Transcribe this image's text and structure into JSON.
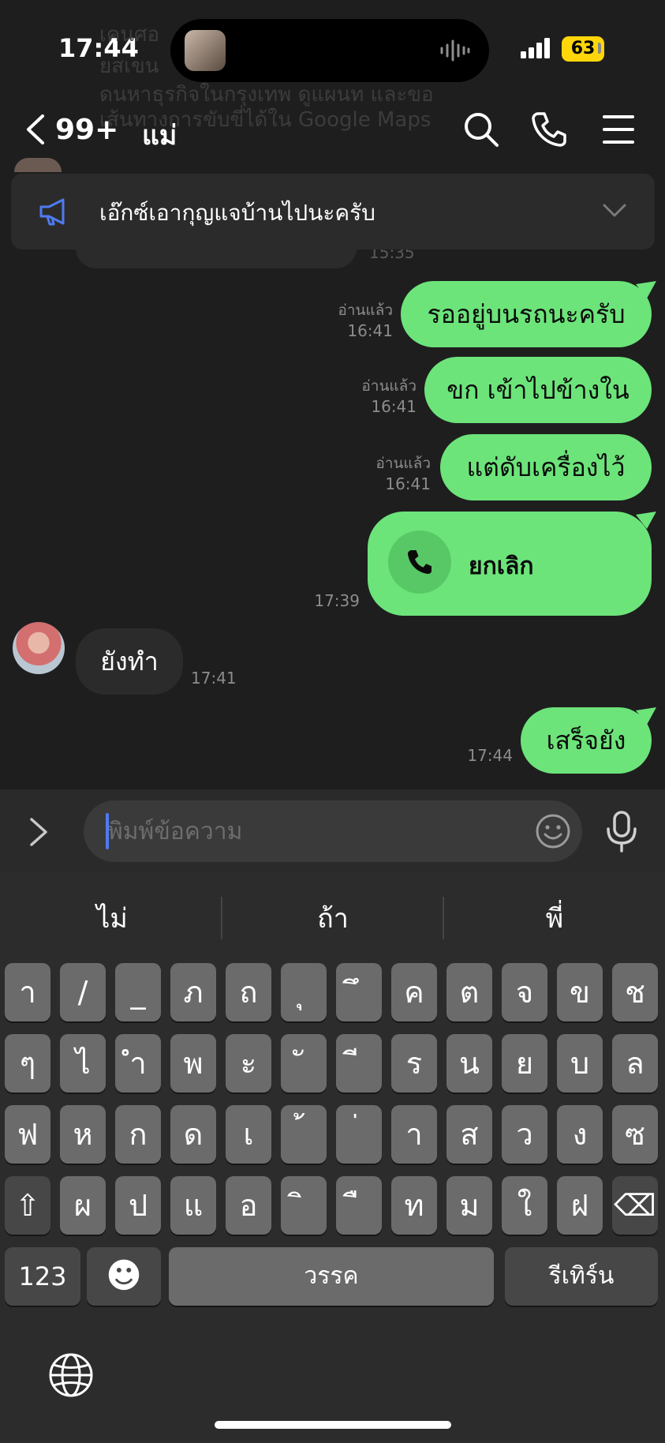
{
  "status_bar": {
    "time": "17:44",
    "battery": "63"
  },
  "ghost_text": [
    "เคนศอ",
    "ยสเขน",
    "ดนหาธุรกิจในกรุงเทพ ดูแผนท และขอ",
    "เส้นทางการขับขี่ได้ใน Google Maps"
  ],
  "header": {
    "unread_count": "99+",
    "chat_name": "แม่"
  },
  "announcement": {
    "text": "เอ๊กซ์เอากุญแจบ้านไปนะครับ"
  },
  "old_message": {
    "time": "15:35"
  },
  "messages": [
    {
      "text": "รออยู่บนรถนะครับ",
      "read": "อ่านแล้ว",
      "time": "16:41"
    },
    {
      "text": "ขก เข้าไปข้างใน",
      "read": "อ่านแล้ว",
      "time": "16:41"
    },
    {
      "text": "แต่ดับเครื่องไว้",
      "read": "อ่านแล้ว",
      "time": "16:41"
    },
    {
      "text": "ยกเลิก",
      "time": "17:39"
    },
    {
      "text": "ยังทำ",
      "time": "17:41"
    },
    {
      "text": "เสร็จยัง",
      "time": "17:44"
    }
  ],
  "input": {
    "placeholder": "พิมพ์ข้อความ"
  },
  "keyboard": {
    "suggestions": [
      "ไม่",
      "ถ้า",
      "พี่"
    ],
    "row1": [
      "า",
      "/",
      "_",
      "ภ",
      "ถ",
      "ุ",
      "ึ",
      "ค",
      "ต",
      "จ",
      "ข",
      "ช"
    ],
    "row2": [
      "ๆ",
      "ไ",
      "ำ",
      "พ",
      "ะ",
      "ั",
      "ี",
      "ร",
      "น",
      "ย",
      "บ",
      "ล"
    ],
    "row3": [
      "ฟ",
      "ห",
      "ก",
      "ด",
      "เ",
      "้",
      "่",
      "า",
      "ส",
      "ว",
      "ง",
      "ซ"
    ],
    "row4": [
      "ผ",
      "ป",
      "แ",
      "อ",
      "ิ",
      "ื",
      "ท",
      "ม",
      "ใ",
      "ฝ"
    ],
    "shift": "⇧",
    "backspace": "⌫",
    "numbers": "123",
    "emoji": "☻",
    "space": "วรรค",
    "return": "รีเทิร์น"
  }
}
